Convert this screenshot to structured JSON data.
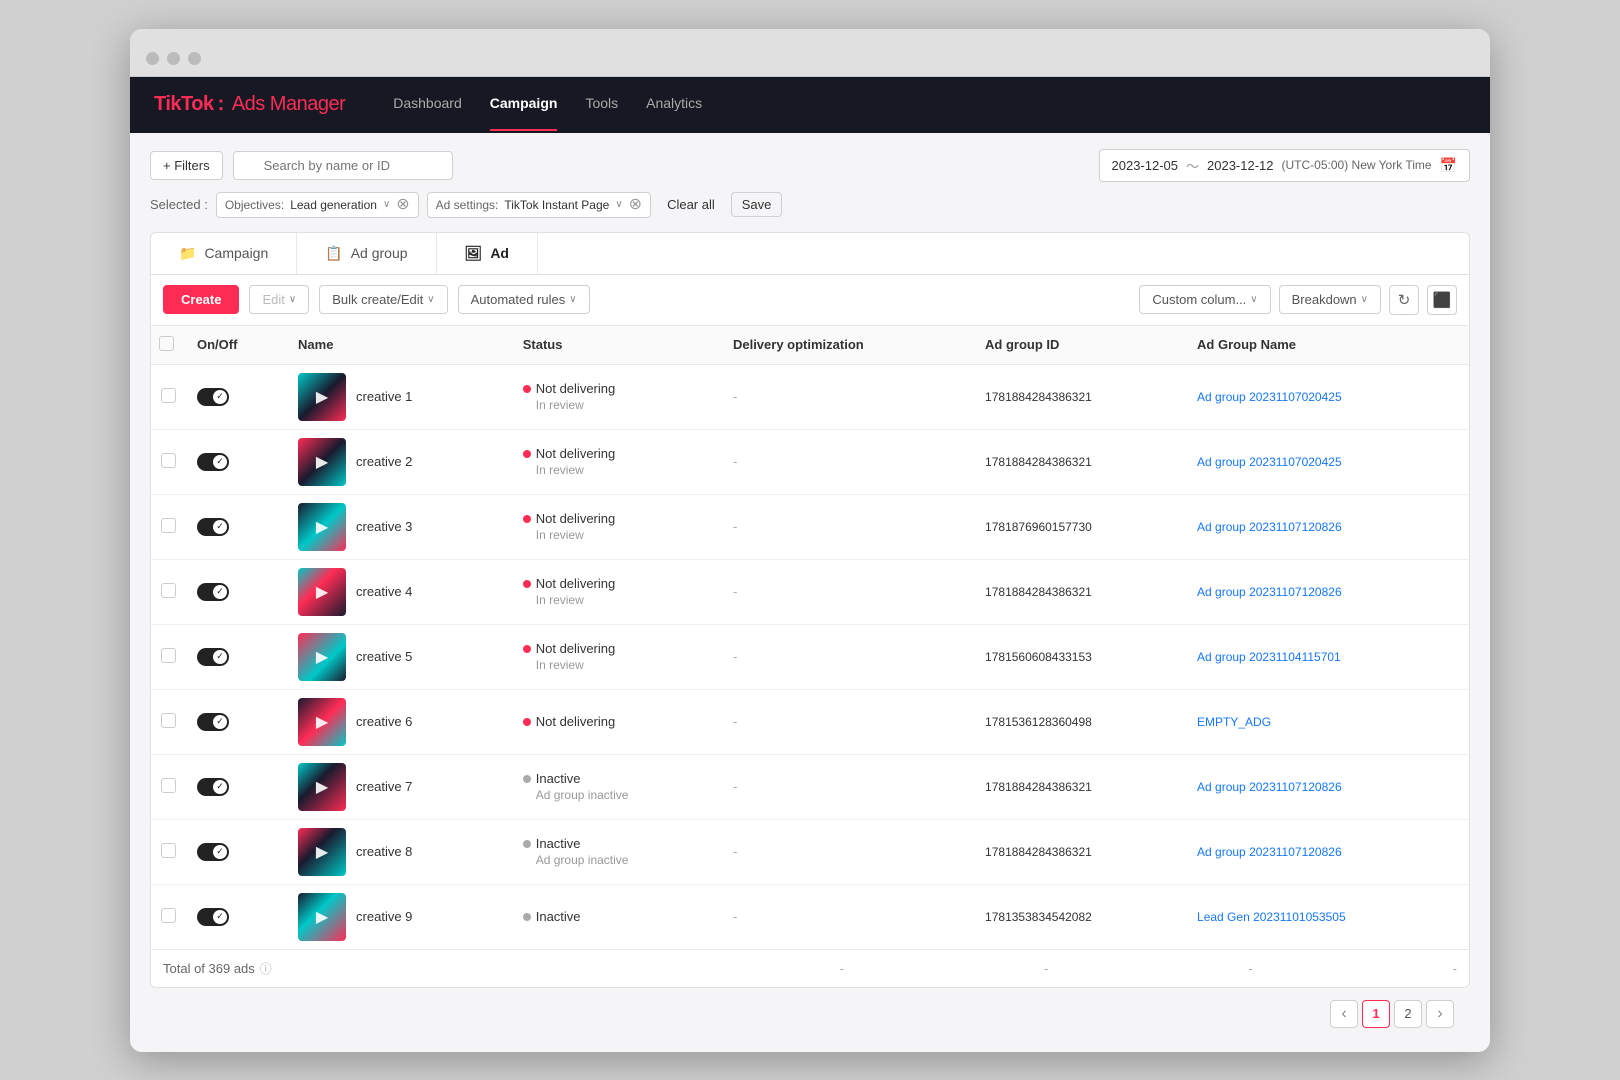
{
  "browser": {
    "dots": [
      "dot1",
      "dot2",
      "dot3"
    ]
  },
  "nav": {
    "logo_brand": "TikTok",
    "logo_colon": ":",
    "logo_sub": "Ads Manager",
    "items": [
      {
        "label": "Dashboard",
        "active": false
      },
      {
        "label": "Campaign",
        "active": true
      },
      {
        "label": "Tools",
        "active": false
      },
      {
        "label": "Analytics",
        "active": false
      }
    ]
  },
  "filters": {
    "filters_btn": "+ Filters",
    "search_placeholder": "Search by name or ID",
    "date_start": "2023-12-05",
    "date_tilde": "～",
    "date_end": "2023-12-12",
    "timezone": "(UTC-05:00) New York Time",
    "selected_label": "Selected :"
  },
  "filter_tags": [
    {
      "key": "Objectives:",
      "value": "Lead generation"
    },
    {
      "key": "Ad settings:",
      "value": "TikTok Instant Page"
    }
  ],
  "filter_actions": {
    "clear_all": "Clear all",
    "save": "Save"
  },
  "tabs": [
    {
      "label": "Campaign",
      "icon": "📁"
    },
    {
      "label": "Ad group",
      "icon": "📋"
    },
    {
      "label": "Ad",
      "icon": "🖼"
    }
  ],
  "toolbar": {
    "create": "Create",
    "edit": "Edit",
    "bulk_create": "Bulk create/Edit",
    "automated_rules": "Automated rules",
    "custom_column": "Custom colum...",
    "breakdown": "Breakdown"
  },
  "table": {
    "columns": [
      "On/Off",
      "Name",
      "Status",
      "Delivery optimization",
      "Ad group ID",
      "Ad Group Name"
    ],
    "rows": [
      {
        "id": 1,
        "toggle": "on",
        "name": "creative 1",
        "status": "Not delivering",
        "status_sub": "In review",
        "status_type": "red",
        "delivery": "-",
        "ad_group_id": "1781884284386321",
        "ad_group_name": "Ad group 20231107020425"
      },
      {
        "id": 2,
        "toggle": "on",
        "name": "creative 2",
        "status": "Not delivering",
        "status_sub": "In review",
        "status_type": "red",
        "delivery": "-",
        "ad_group_id": "1781884284386321",
        "ad_group_name": "Ad group 20231107020425"
      },
      {
        "id": 3,
        "toggle": "on",
        "name": "creative 3",
        "status": "Not delivering",
        "status_sub": "In review",
        "status_type": "red",
        "delivery": "-",
        "ad_group_id": "1781876960157730",
        "ad_group_name": "Ad group 20231107120826"
      },
      {
        "id": 4,
        "toggle": "on",
        "name": "creative 4",
        "status": "Not delivering",
        "status_sub": "In review",
        "status_type": "red",
        "delivery": "-",
        "ad_group_id": "1781884284386321",
        "ad_group_name": "Ad group 20231107120826"
      },
      {
        "id": 5,
        "toggle": "on",
        "name": "creative 5",
        "status": "Not delivering",
        "status_sub": "In review",
        "status_type": "red",
        "delivery": "-",
        "ad_group_id": "1781560608433153",
        "ad_group_name": "Ad group 20231104115701"
      },
      {
        "id": 6,
        "toggle": "on",
        "name": "creative 6",
        "status": "Not delivering",
        "status_sub": "",
        "status_type": "red",
        "delivery": "-",
        "ad_group_id": "1781536128360498",
        "ad_group_name": "EMPTY_ADG"
      },
      {
        "id": 7,
        "toggle": "on",
        "name": "creative 7",
        "status": "Inactive",
        "status_sub": "Ad group inactive",
        "status_type": "gray",
        "delivery": "-",
        "ad_group_id": "1781884284386321",
        "ad_group_name": "Ad group 20231107120826"
      },
      {
        "id": 8,
        "toggle": "on",
        "name": "creative 8",
        "status": "Inactive",
        "status_sub": "Ad group inactive",
        "status_type": "gray",
        "delivery": "-",
        "ad_group_id": "1781884284386321",
        "ad_group_name": "Ad group 20231107120826"
      },
      {
        "id": 9,
        "toggle": "on",
        "name": "creative 9",
        "status": "Inactive",
        "status_sub": "",
        "status_type": "gray",
        "delivery": "-",
        "ad_group_id": "1781353834542082",
        "ad_group_name": "Lead Gen 20231101053505"
      }
    ],
    "footer_total": "Total of 369 ads",
    "footer_dash": "-"
  },
  "pagination": {
    "prev": "‹",
    "pages": [
      "1",
      "2"
    ],
    "active_page": "1",
    "next": "›"
  }
}
